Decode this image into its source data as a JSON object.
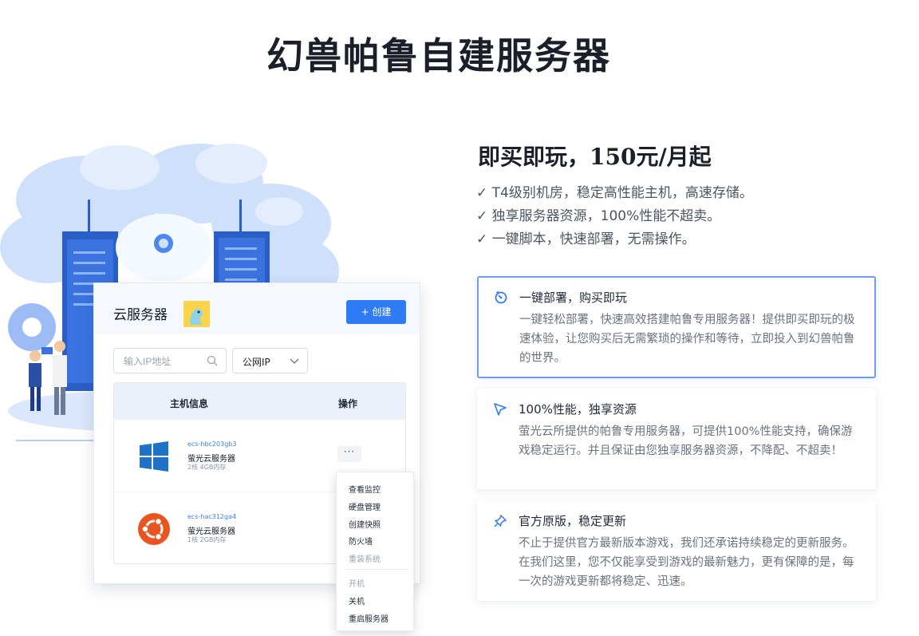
{
  "page": {
    "title": "幻兽帕鲁自建服务器"
  },
  "server_panel": {
    "title": "云服务器",
    "create_button": "+ 创建",
    "search_placeholder": "输入IP地址",
    "ip_type_selected": "公网IP",
    "table_headers": {
      "host_info": "主机信息",
      "actions": "操作"
    },
    "servers": [
      {
        "id": "ecs-hbc203gb3",
        "name": "萤光云服务器",
        "spec": "2核 4GB内存",
        "os": "windows-icon"
      },
      {
        "id": "ecs-hac312ga4",
        "name": "萤光云服务器",
        "spec": "1核 2GB内存",
        "os": "ubuntu-icon"
      }
    ],
    "more_label": "···",
    "menu": {
      "items": [
        "查看监控",
        "硬盘管理",
        "创建快照",
        "防火墙"
      ],
      "disabled_items": [
        "重装系统",
        "开机"
      ],
      "power_items": [
        "关机",
        "重启服务器"
      ]
    }
  },
  "promo": {
    "headline": "即买即玩，150元/月起",
    "bullets": [
      "✓ T4级别机房，稳定高性能主机，高速存储。",
      "✓ 独享服务器资源，100%性能不超卖。",
      "✓ 一键脚本，快速部署，无需操作。"
    ],
    "features": [
      {
        "icon": "timer-icon",
        "title": "一键部署，购买即玩",
        "desc": "一键轻松部署，快速高效搭建帕鲁专用服务器！提供即买即玩的极速体验，让您购买后无需繁琐的操作和等待，立即投入到幻兽帕鲁的世界。"
      },
      {
        "icon": "cursor-arrow-icon",
        "title": "100%性能，独享资源",
        "desc": "萤光云所提供的帕鲁专用服务器，可提供100%性能支持，确保游戏稳定运行。并且保证由您独享服务器资源，不降配、不超卖！"
      },
      {
        "icon": "pin-icon",
        "title": "官方原版，稳定更新",
        "desc": "不止于提供官方最新版本游戏，我们还承诺持续稳定的更新服务。在我们这里，您不仅能享受到游戏的最新魅力，更有保障的是，每一次的游戏更新都将稳定、迅速。"
      }
    ]
  },
  "colors": {
    "accent": "#2f7bf5",
    "active_border": "#6f9bf5",
    "ubuntu": "#e95420",
    "windows": "#1e73c8"
  }
}
